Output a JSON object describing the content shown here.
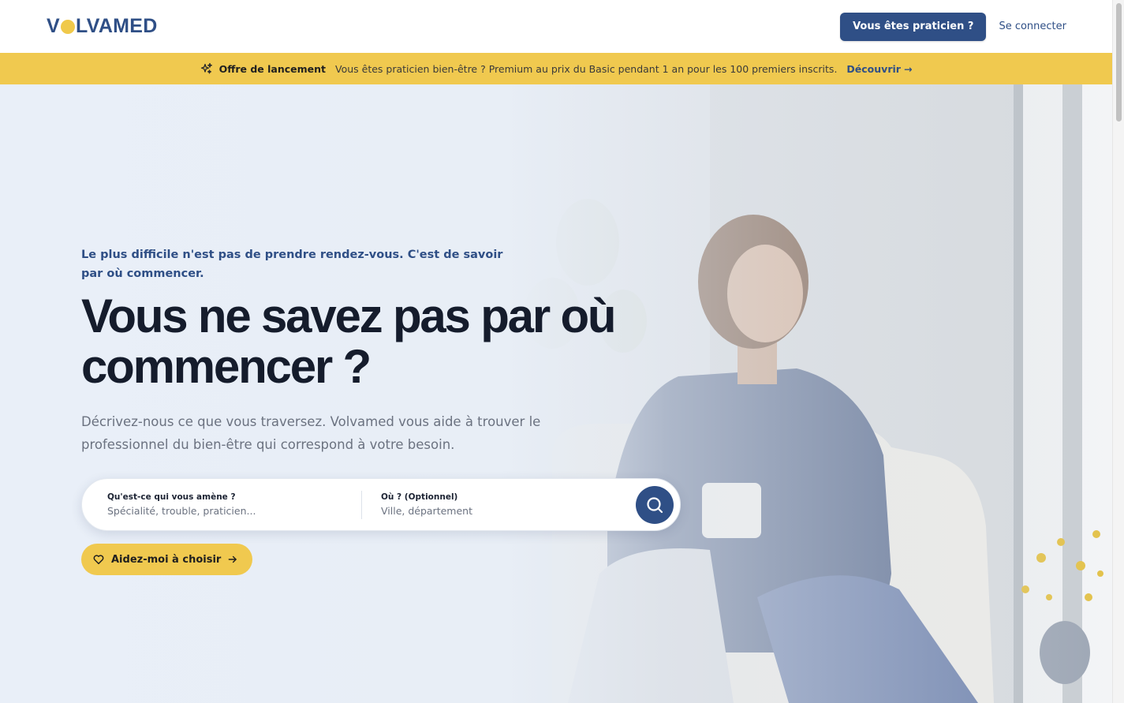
{
  "header": {
    "logo_left": "V",
    "logo_right": "LVAMED",
    "practitioner_button": "Vous êtes praticien ?",
    "login_link": "Se connecter"
  },
  "banner": {
    "icon": "sparkles-icon",
    "title": "Offre de lancement",
    "text": "Vous êtes praticien bien-être ? Premium au prix du Basic pendant 1 an pour les 100 premiers inscrits.",
    "link": "Découvrir",
    "link_arrow": "→"
  },
  "hero": {
    "kicker": "Le plus difficile n'est pas de prendre rendez-vous. C'est de savoir par où commencer.",
    "headline": "Vous ne savez pas par où commencer ?",
    "subtitle": "Décrivez-nous ce que vous traversez. Volvamed vous aide à trouver le professionnel du bien-être qui correspond à votre besoin."
  },
  "search": {
    "what_label": "Qu'est-ce qui vous amène ?",
    "what_placeholder": "Spécialité, trouble, praticien...",
    "where_label": "Où ? (Optionnel)",
    "where_placeholder": "Ville, département",
    "button_icon": "search-icon"
  },
  "help_button": {
    "icon": "heart-icon",
    "label": "Aidez-moi à choisir",
    "arrow_icon": "arrow-right-icon"
  },
  "colors": {
    "brand_blue": "#2f4f86",
    "brand_yellow": "#f0c94f",
    "headline": "#151c2c"
  }
}
